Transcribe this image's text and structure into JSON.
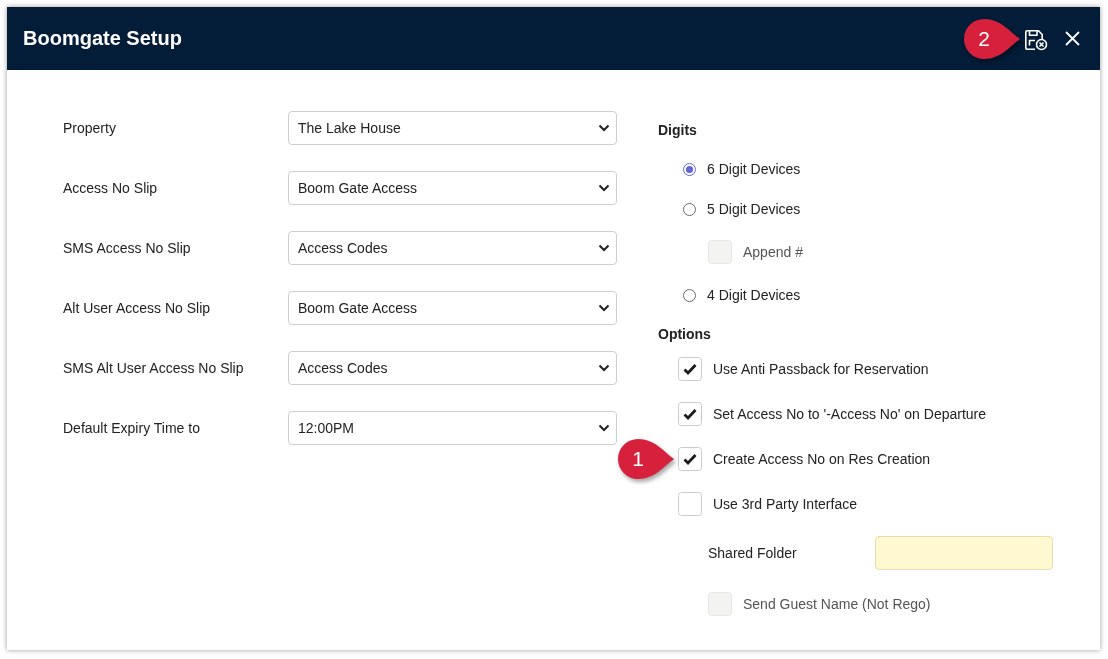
{
  "window": {
    "title": "Boomgate Setup",
    "actions": [
      {
        "kind": "save-cancel",
        "callout": "2"
      },
      {
        "kind": "close"
      }
    ]
  },
  "fields": [
    {
      "label": "Property",
      "value": "The Lake House"
    },
    {
      "label": "Access No Slip",
      "value": "Boom Gate Access"
    },
    {
      "label": "SMS Access No Slip",
      "value": "Access Codes"
    },
    {
      "label": "Alt User Access No Slip",
      "value": "Boom Gate Access"
    },
    {
      "label": "SMS Alt User Access No Slip",
      "value": "Access Codes"
    },
    {
      "label": "Default Expiry Time to",
      "value": "12:00PM"
    }
  ],
  "digits": {
    "heading": "Digits",
    "items": [
      {
        "label": "6 Digit Devices",
        "selected": true
      },
      {
        "label": "5 Digit Devices",
        "selected": false,
        "children": [
          {
            "label": "Append #",
            "checked": false,
            "disabled": true
          }
        ]
      },
      {
        "label": "4 Digit Devices",
        "selected": false
      }
    ]
  },
  "options": {
    "heading": "Options",
    "items": [
      {
        "label": "Use Anti Passback for Reservation",
        "checked": true,
        "disabled": false
      },
      {
        "label": "Set Access No to '-Access No' on Departure",
        "checked": true,
        "disabled": false
      },
      {
        "label": "Create Access No on Res Creation",
        "checked": true,
        "disabled": false,
        "callout": "1"
      },
      {
        "label": "Use 3rd Party Interface",
        "checked": false,
        "disabled": false,
        "children": [
          {
            "kind": "text-field",
            "label": "Shared Folder"
          },
          {
            "kind": "checkbox",
            "label": "Send Guest Name (Not Rego)",
            "checked": false,
            "disabled": true
          }
        ]
      }
    ]
  }
}
